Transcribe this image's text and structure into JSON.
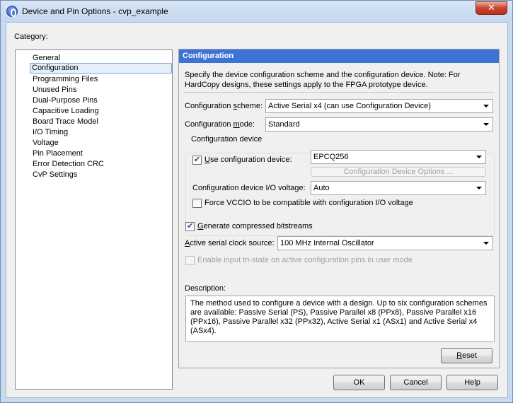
{
  "window": {
    "title": "Device and Pin Options - cvp_example",
    "close_glyph": "✕"
  },
  "category": {
    "label": "Category:",
    "items": [
      {
        "label": "General"
      },
      {
        "label": "Configuration"
      },
      {
        "label": "Programming Files"
      },
      {
        "label": "Unused Pins"
      },
      {
        "label": "Dual-Purpose Pins"
      },
      {
        "label": "Capacitive Loading"
      },
      {
        "label": "Board Trace Model"
      },
      {
        "label": "I/O Timing"
      },
      {
        "label": "Voltage"
      },
      {
        "label": "Pin Placement"
      },
      {
        "label": "Error Detection CRC"
      },
      {
        "label": "CvP Settings"
      }
    ],
    "selected": "Configuration"
  },
  "panel": {
    "header": "Configuration",
    "intro": "Specify the device configuration scheme and the configuration device. Note: For HardCopy designs, these settings apply to the FPGA prototype device.",
    "scheme_label_pre": "Configuration ",
    "scheme_label_ul": "s",
    "scheme_label_post": "cheme:",
    "scheme_value": "Active Serial x4 (can use Configuration Device)",
    "mode_label_pre": "Configuration ",
    "mode_label_ul": "m",
    "mode_label_post": "ode:",
    "mode_value": "Standard",
    "group_title": "Configuration device",
    "use_device_ul": "U",
    "use_device_post": "se configuration device:",
    "use_device_checked": true,
    "device_value": "EPCQ256",
    "device_options_button": "Configuration Device Options ...",
    "io_voltage_label": "Configuration device I/O voltage:",
    "io_voltage_value": "Auto",
    "force_vccio_label": "Force VCCIO to be compatible with configuration I/O voltage",
    "force_vccio_checked": false,
    "generate_ul": "G",
    "generate_post": "enerate compressed bitstreams",
    "generate_checked": true,
    "clock_label_ul": "A",
    "clock_label_post": "ctive serial clock source:",
    "clock_value": "100 MHz Internal Oscillator",
    "tristate_label": "Enable input tri-state on active configuration pins in user mode",
    "tristate_checked": false,
    "description_label": "Description:",
    "description_text": "The method used to configure a device with a design. Up to six configuration schemes are available: Passive Serial (PS), Passive Parallel x8 (PPx8), Passive Parallel x16 (PPx16), Passive Parallel x32 (PPx32), Active Serial x1 (ASx1) and Active Serial x4 (ASx4).",
    "reset_ul": "R",
    "reset_post": "eset"
  },
  "footer": {
    "ok": "OK",
    "cancel": "Cancel",
    "help": "Help"
  },
  "colors": {
    "header_blue": "#3c73d4",
    "selection": "#e5effb",
    "close_red": "#c9442e"
  }
}
